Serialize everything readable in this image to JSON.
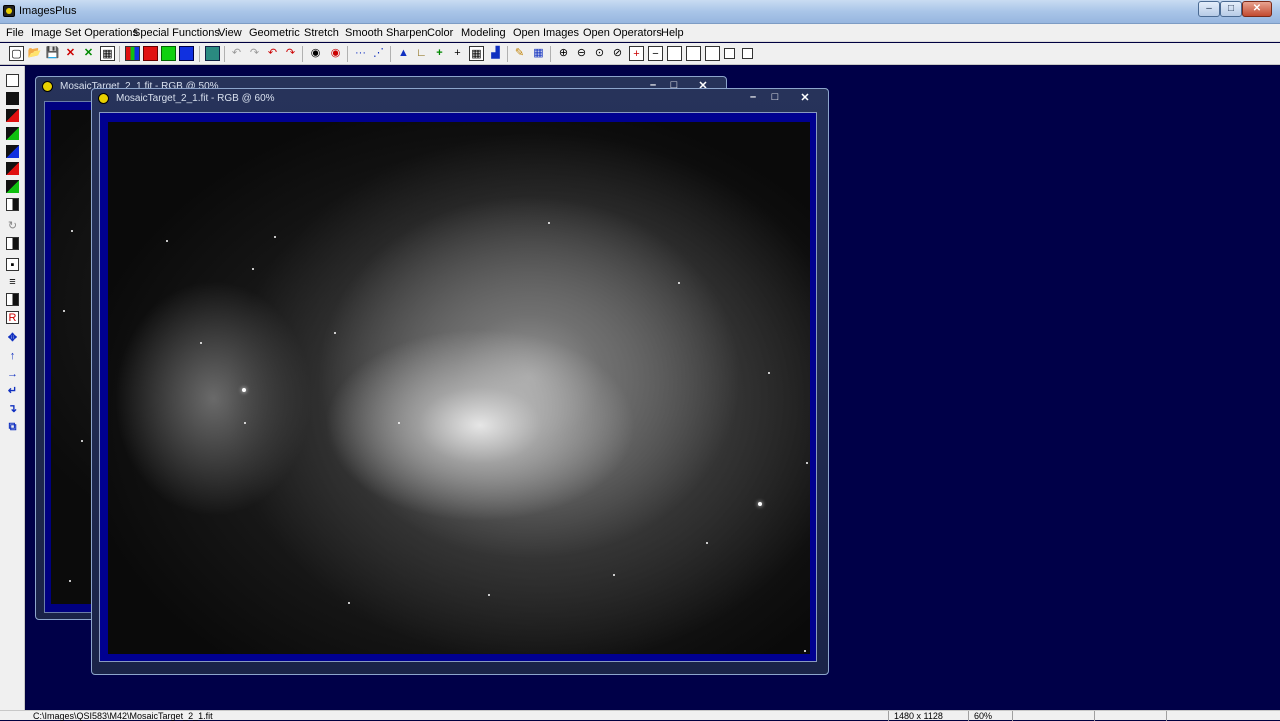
{
  "app": {
    "title": "ImagesPlus"
  },
  "window_controls": {
    "minimize": "–",
    "maximize": "□",
    "close": "✕"
  },
  "menu": [
    "File",
    "Image Set Operations",
    "Special Functions",
    "View",
    "Geometric",
    "Stretch",
    "Smooth Sharpen",
    "Color",
    "Modeling",
    "Open Images",
    "Open Operators",
    "Help"
  ],
  "windows": {
    "back": {
      "title": "MosaicTarget_2_1.fit - RGB @ 50%"
    },
    "front": {
      "title": "MosaicTarget_2_1.fit - RGB @ 60%"
    }
  },
  "status": {
    "path": "C:\\Images\\QSI583\\M42\\MosaicTarget_2_1.fit",
    "dimensions": "1480 x 1128",
    "zoom": "60%"
  },
  "colors": {
    "mdi_background": "#000048",
    "canvas_border": "#000090"
  }
}
